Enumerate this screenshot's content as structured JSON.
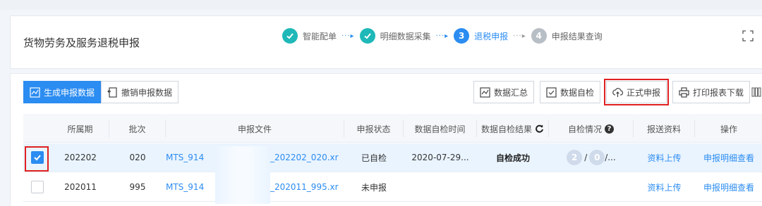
{
  "header": {
    "title": "货物劳务及服务退税申报",
    "steps": [
      {
        "num": "",
        "label": "智能配单",
        "status": "done"
      },
      {
        "num": "",
        "label": "明细数据采集",
        "status": "done"
      },
      {
        "num": "3",
        "label": "退税申报",
        "status": "active"
      },
      {
        "num": "4",
        "label": "申报结果查询",
        "status": "pending"
      }
    ],
    "arrow": "···▸"
  },
  "toolbar": {
    "generate": "生成申报数据",
    "revoke": "撤销申报数据",
    "summary": "数据汇总",
    "self_check": "数据自检",
    "formal_declare": "正式申报",
    "print_download": "打印报表下载"
  },
  "table": {
    "columns": [
      "所属期",
      "批次",
      "申报文件",
      "申报状态",
      "数据自检时间",
      "数据自检结果",
      "自检情况",
      "报送资料",
      "操作"
    ],
    "rows": [
      {
        "checked": true,
        "period": "202202",
        "batch": "020",
        "file_prefix": "MTS_914",
        "file_suffix": "_202202_020.xr",
        "status": "已自检",
        "check_time": "2020-07-29...",
        "check_result": "自检成功",
        "check_count_a": "2",
        "check_count_b": "0",
        "check_tail": "/...",
        "upload": "资料上传",
        "detail": "申报明细查看"
      },
      {
        "checked": false,
        "period": "202011",
        "batch": "995",
        "file_prefix": "MTS_914",
        "file_suffix": "_202011_995.xr",
        "status": "未申报",
        "check_time": "",
        "check_result": "",
        "check_count_a": "",
        "check_count_b": "",
        "check_tail": "",
        "upload": "资料上传",
        "detail": "申报明细查看"
      }
    ]
  },
  "colors": {
    "accent": "#2b8cf1",
    "done": "#1fb8b8",
    "highlight": "#e02020"
  }
}
